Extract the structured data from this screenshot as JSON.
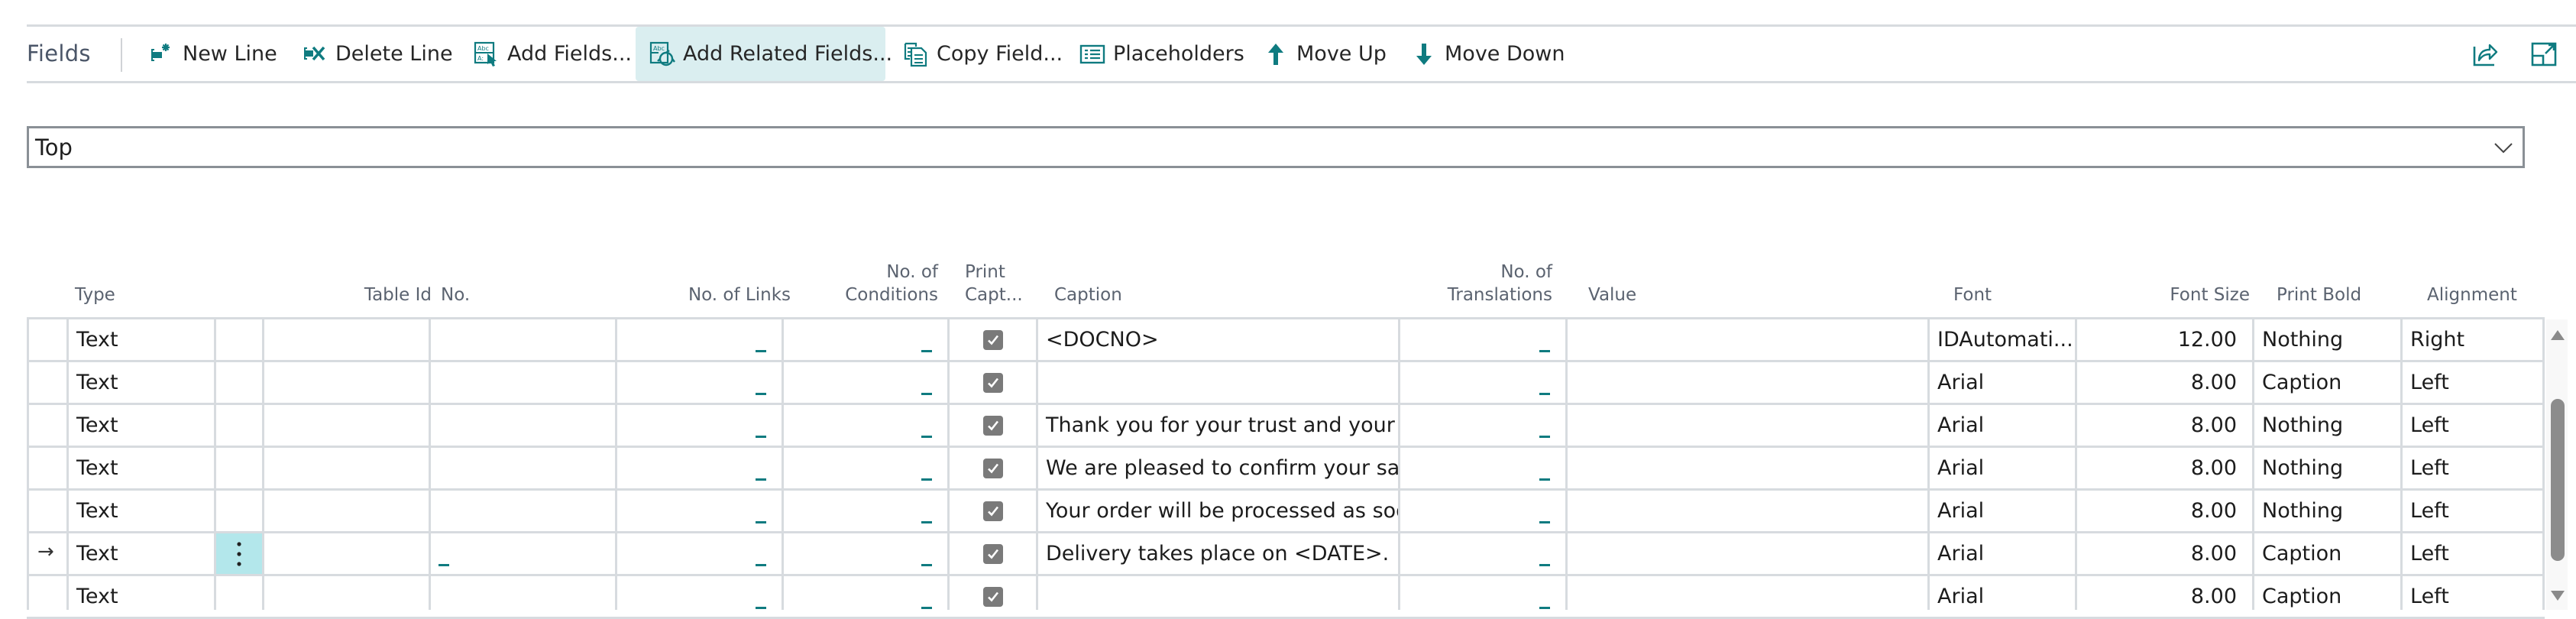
{
  "actionbar": {
    "title": "Fields",
    "buttons": {
      "new_line": "New Line",
      "delete_line": "Delete Line",
      "add_fields": "Add Fields...",
      "add_related_fields": "Add Related Fields...",
      "copy_field": "Copy Field...",
      "placeholders": "Placeholders",
      "move_up": "Move Up",
      "move_down": "Move Down"
    },
    "active_button": "add_related_fields",
    "right_icons": [
      "share-icon",
      "expand-icon"
    ]
  },
  "lookup": {
    "value": "Top"
  },
  "grid": {
    "columns": {
      "type": "Type",
      "table_id": "Table Id",
      "no": "No.",
      "no_of_links": "No. of Links",
      "no_of_conditions_1": "No. of",
      "no_of_conditions_2": "Conditions",
      "print_caption_1": "Print",
      "print_caption_2": "Capt...",
      "caption": "Caption",
      "no_of_translations_1": "No. of",
      "no_of_translations_2": "Translations",
      "value": "Value",
      "font": "Font",
      "font_size": "Font Size",
      "print_bold": "Print Bold",
      "alignment": "Alignment"
    },
    "current_row_index": 5,
    "rows": [
      {
        "type": "Text",
        "table_id": "",
        "no": "",
        "no_of_links": "_",
        "no_of_conditions": "_",
        "print_caption": true,
        "caption": "<DOCNO>",
        "no_of_translations": "_",
        "value": "",
        "font": "IDAutomati...",
        "font_size": "12.00",
        "print_bold": "Nothing",
        "alignment": "Right"
      },
      {
        "type": "Text",
        "table_id": "",
        "no": "",
        "no_of_links": "_",
        "no_of_conditions": "_",
        "print_caption": true,
        "caption": "",
        "no_of_translations": "_",
        "value": "",
        "font": "Arial",
        "font_size": "8.00",
        "print_bold": "Caption",
        "alignment": "Left"
      },
      {
        "type": "Text",
        "table_id": "",
        "no": "",
        "no_of_links": "_",
        "no_of_conditions": "_",
        "print_caption": true,
        "caption": "Thank you for your trust and your ...",
        "no_of_translations": "_",
        "value": "",
        "font": "Arial",
        "font_size": "8.00",
        "print_bold": "Nothing",
        "alignment": "Left"
      },
      {
        "type": "Text",
        "table_id": "",
        "no": "",
        "no_of_links": "_",
        "no_of_conditions": "_",
        "print_caption": true,
        "caption": "We are pleased to confirm your sal...",
        "no_of_translations": "_",
        "value": "",
        "font": "Arial",
        "font_size": "8.00",
        "print_bold": "Nothing",
        "alignment": "Left"
      },
      {
        "type": "Text",
        "table_id": "",
        "no": "",
        "no_of_links": "_",
        "no_of_conditions": "_",
        "print_caption": true,
        "caption": "Your order will be processed as soo...",
        "no_of_translations": "_",
        "value": "",
        "font": "Arial",
        "font_size": "8.00",
        "print_bold": "Nothing",
        "alignment": "Left"
      },
      {
        "type": "Text",
        "table_id": "",
        "no": "_",
        "no_of_links": "_",
        "no_of_conditions": "_",
        "print_caption": true,
        "caption": "Delivery takes place on <DATE>.",
        "no_of_translations": "_",
        "value": "",
        "font": "Arial",
        "font_size": "8.00",
        "print_bold": "Caption",
        "alignment": "Left"
      },
      {
        "type": "Text",
        "table_id": "",
        "no": "",
        "no_of_links": "_",
        "no_of_conditions": "_",
        "print_caption": true,
        "caption": "",
        "no_of_translations": "_",
        "value": "",
        "font": "Arial",
        "font_size": "8.00",
        "print_bold": "Caption",
        "alignment": "Left"
      }
    ]
  },
  "colors": {
    "accent": "#0f7b80",
    "active_button_bg": "#daeef0",
    "current_row_menu_bg": "#b3e7eb",
    "grid_line": "#d7dbdf",
    "header_text": "#5b6370"
  }
}
